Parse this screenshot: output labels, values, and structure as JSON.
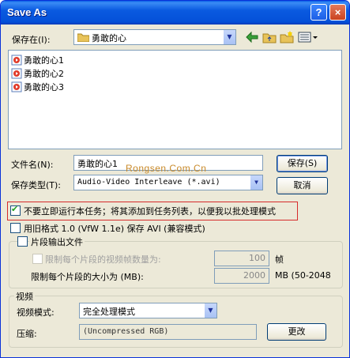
{
  "window": {
    "title": "Save As",
    "help_label": "?",
    "close_label": "×"
  },
  "toolbar": {
    "save_in_label": "保存在(I):",
    "save_in_value": "勇敢的心",
    "icons": [
      "back-arrow-icon",
      "up-folder-icon",
      "new-folder-icon",
      "view-menu-icon"
    ]
  },
  "files": [
    {
      "name": "勇敢的心1"
    },
    {
      "name": "勇敢的心2"
    },
    {
      "name": "勇敢的心3"
    }
  ],
  "filename": {
    "label": "文件名(N):",
    "value": "勇敢的心1"
  },
  "filetype": {
    "label": "保存类型(T):",
    "value": "Audio-Video Interleave (*.avi)"
  },
  "buttons": {
    "save": "保存(S)",
    "cancel": "取消",
    "change": "更改"
  },
  "watermark": "Rongsen.Com.Cn",
  "options": {
    "batch_label": "不要立即运行本任务；将其添加到任务列表，以便我以批处理模式",
    "batch_checked": true,
    "old_format_label": "用旧格式 1.0 (VfW 1.1e) 保存 AVI (兼容模式)",
    "old_format_checked": false
  },
  "segment": {
    "group_label": "片段输出文件",
    "limit_frames_label": "限制每个片段的视频帧数量为:",
    "limit_frames_value": "100",
    "limit_frames_unit": "帧",
    "limit_size_label": "限制每个片段的大小为 (MB):",
    "limit_size_value": "2000",
    "limit_size_unit": "MB (50-2048"
  },
  "video": {
    "group_label": "视频",
    "mode_label": "视频模式:",
    "mode_value": "完全处理模式",
    "compress_label": "压缩:",
    "compress_value": "(Uncompressed RGB)"
  },
  "colors": {
    "titlebar": "#0a5ae0",
    "dialog_bg": "#ece9d8",
    "highlight": "#d62b2b"
  }
}
